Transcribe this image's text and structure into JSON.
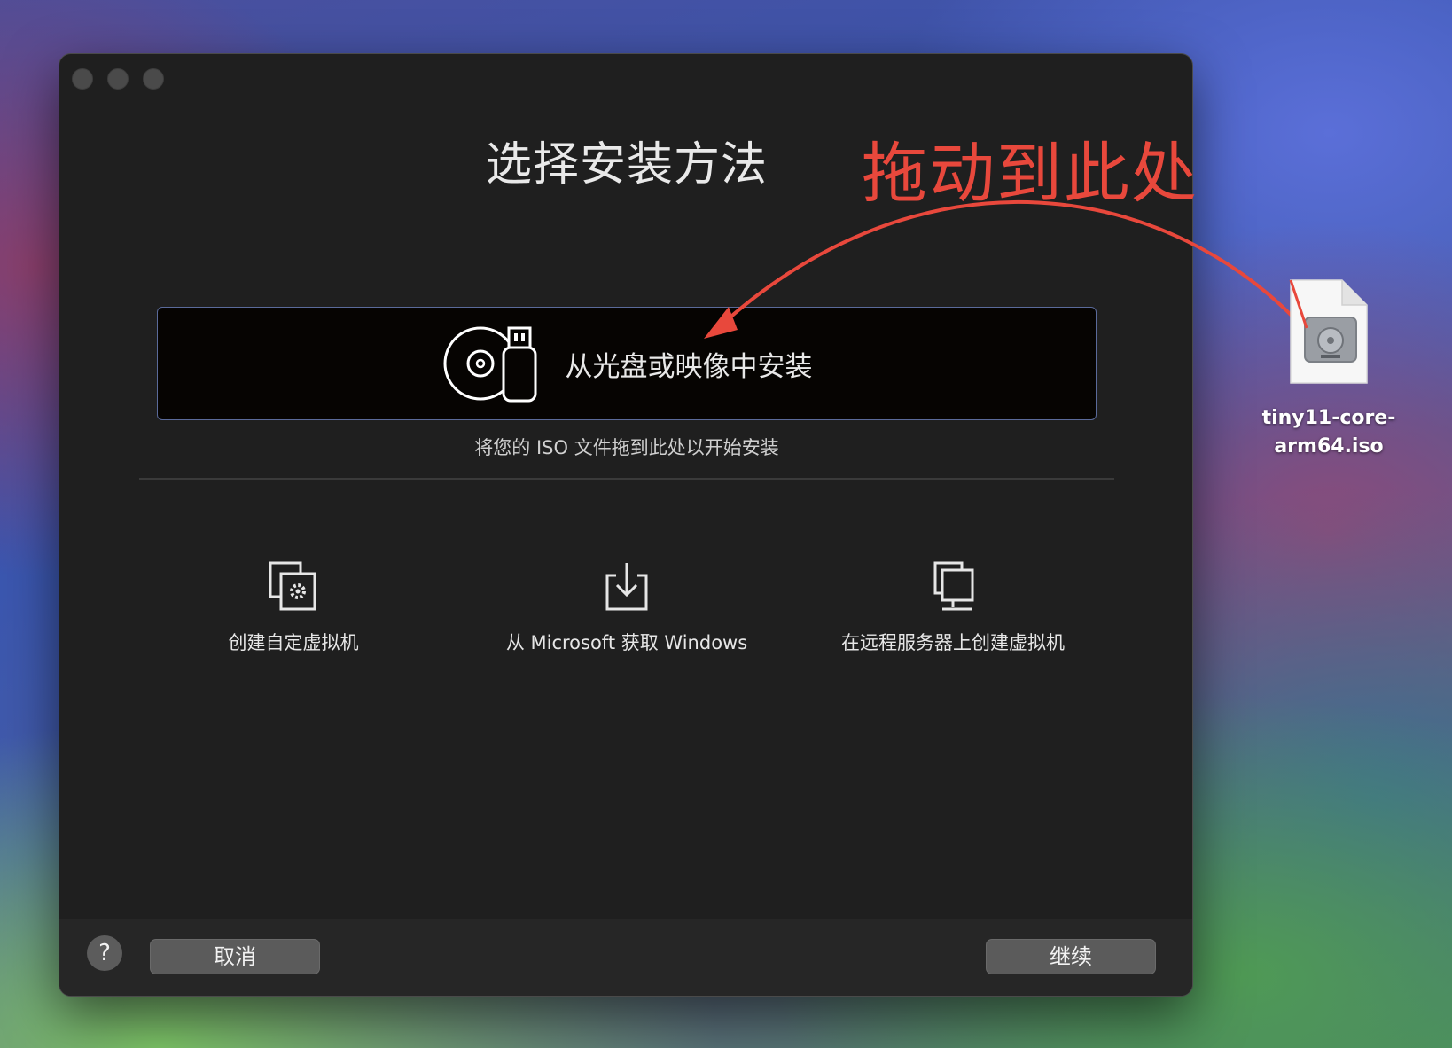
{
  "window": {
    "title": "选择安装方法",
    "install_option": {
      "label": "从光盘或映像中安装",
      "icon": "disc-usb-icon"
    },
    "drop_hint": "将您的 ISO 文件拖到此处以开始安装",
    "options": [
      {
        "label": "创建自定虚拟机",
        "icon": "custom-vm-icon"
      },
      {
        "label": "从 Microsoft 获取 Windows",
        "icon": "download-icon"
      },
      {
        "label": "在远程服务器上创建虚拟机",
        "icon": "remote-server-icon"
      }
    ],
    "footer": {
      "help": "?",
      "cancel": "取消",
      "continue": "继续"
    }
  },
  "annotation": {
    "text": "拖动到此处",
    "color": "#e8483c"
  },
  "desktop_file": {
    "name": "tiny11-core-\narm64.iso",
    "icon": "disk-image-icon"
  }
}
